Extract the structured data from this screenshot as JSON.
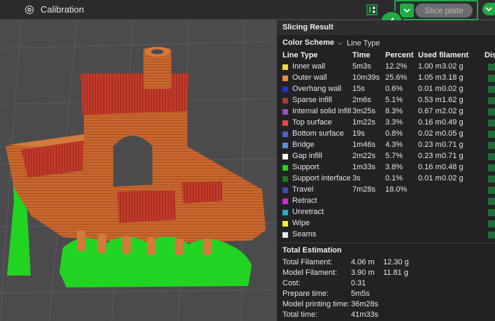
{
  "topbar": {
    "calibration_label": "Calibration",
    "slice_label": "Slice plate",
    "step_number": "4"
  },
  "panel": {
    "title": "Slicing Result",
    "color_scheme_label": "Color Scheme",
    "color_scheme_value": "Line Type",
    "headers": {
      "line_type": "Line Type",
      "time": "Time",
      "percent": "Percent",
      "used_filament": "Used filament",
      "display": "Dis"
    },
    "rows": [
      {
        "name": "Inner wall",
        "time": "5m3s",
        "percent": "12.2%",
        "len": "1.00 m",
        "weight": "3.02 g",
        "color": "#f2d640"
      },
      {
        "name": "Outer wall",
        "time": "10m39s",
        "percent": "25.6%",
        "len": "1.05 m",
        "weight": "3.18 g",
        "color": "#f28a3c"
      },
      {
        "name": "Overhang wall",
        "time": "15s",
        "percent": "0.6%",
        "len": "0.01 m",
        "weight": "0.02 g",
        "color": "#2a2ad0"
      },
      {
        "name": "Sparse infill",
        "time": "2m6s",
        "percent": "5.1%",
        "len": "0.53 m",
        "weight": "1.62 g",
        "color": "#b03a2e"
      },
      {
        "name": "Internal solid infill",
        "time": "3m25s",
        "percent": "8.3%",
        "len": "0.67 m",
        "weight": "2.02 g",
        "color": "#9b4fc2"
      },
      {
        "name": "Top surface",
        "time": "1m22s",
        "percent": "3.3%",
        "len": "0.16 m",
        "weight": "0.49 g",
        "color": "#e04848"
      },
      {
        "name": "Bottom surface",
        "time": "19s",
        "percent": "0.8%",
        "len": "0.02 m",
        "weight": "0.05 g",
        "color": "#4f5fd0"
      },
      {
        "name": "Bridge",
        "time": "1m46s",
        "percent": "4.3%",
        "len": "0.23 m",
        "weight": "0.71 g",
        "color": "#5a8ad8"
      },
      {
        "name": "Gap infill",
        "time": "2m22s",
        "percent": "5.7%",
        "len": "0.23 m",
        "weight": "0.71 g",
        "color": "#ffffff"
      },
      {
        "name": "Support",
        "time": "1m33s",
        "percent": "3.8%",
        "len": "0.16 m",
        "weight": "0.48 g",
        "color": "#22d422"
      },
      {
        "name": "Support interface",
        "time": "3s",
        "percent": "0.1%",
        "len": "0.01 m",
        "weight": "0.02 g",
        "color": "#1e7a1e"
      },
      {
        "name": "Travel",
        "time": "7m28s",
        "percent": "18.0%",
        "len": "",
        "weight": "",
        "color": "#3a4fa8"
      },
      {
        "name": "Retract",
        "time": "",
        "percent": "",
        "len": "",
        "weight": "",
        "color": "#d02ad0"
      },
      {
        "name": "Unretract",
        "time": "",
        "percent": "",
        "len": "",
        "weight": "",
        "color": "#20b0c8"
      },
      {
        "name": "Wipe",
        "time": "",
        "percent": "",
        "len": "",
        "weight": "",
        "color": "#f2f22a"
      },
      {
        "name": "Seams",
        "time": "",
        "percent": "",
        "len": "",
        "weight": "",
        "color": "#e8e8e8"
      }
    ],
    "total_title": "Total Estimation",
    "estimation": [
      {
        "label": "Total Filament:",
        "len": "4.06 m",
        "weight": "12.30 g"
      },
      {
        "label": "Model Filament:",
        "len": "3.90 m",
        "weight": "11.81 g"
      },
      {
        "label": "Cost:",
        "len": "0.31",
        "weight": ""
      },
      {
        "label": "Prepare time:",
        "len": "5m5s",
        "weight": ""
      },
      {
        "label": "Model printing time:",
        "len": "36m28s",
        "weight": ""
      },
      {
        "label": "Total time:",
        "len": "41m33s",
        "weight": ""
      }
    ]
  },
  "colors": {
    "accent_green": "#1faa43",
    "model_orange": "#c8672f",
    "support_green": "#22d422",
    "panel_bg": "#222225"
  }
}
